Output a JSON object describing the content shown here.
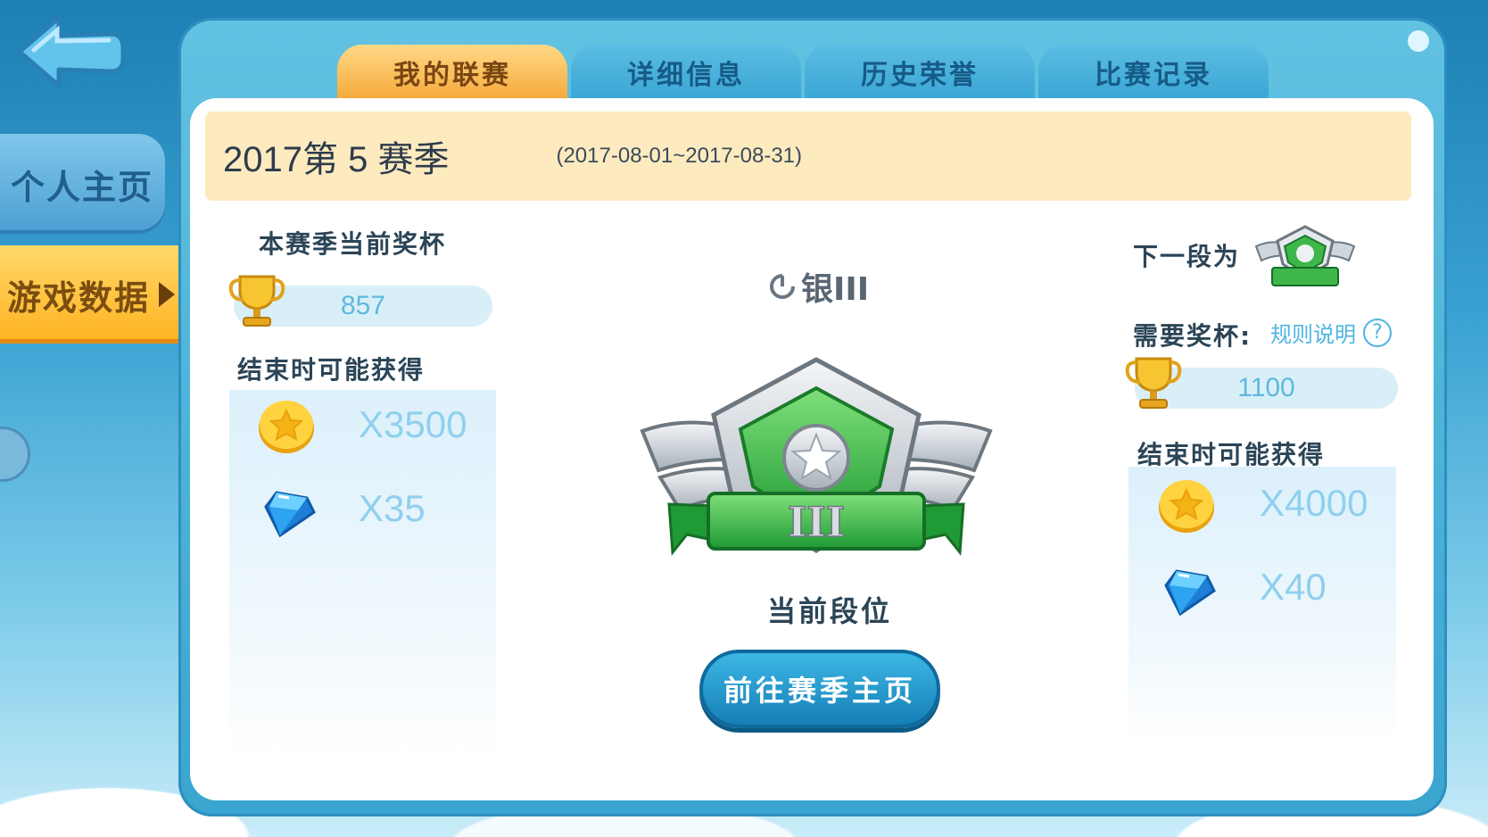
{
  "sidebar": {
    "items": [
      {
        "label": "个人主页"
      },
      {
        "label": "游戏数据"
      }
    ]
  },
  "tabs": [
    {
      "label": "我的联赛",
      "active": true
    },
    {
      "label": "详细信息",
      "active": false
    },
    {
      "label": "历史荣誉",
      "active": false
    },
    {
      "label": "比赛记录",
      "active": false
    }
  ],
  "season": {
    "title": "2017第 5 赛季",
    "dates": "(2017-08-01~2017-08-31)"
  },
  "current": {
    "trophy_label": "本赛季当前奖杯",
    "trophies": "857",
    "rewards_label": "结束时可能获得",
    "coins": "X3500",
    "gems": "X35"
  },
  "rank": {
    "name": "银III",
    "caption": "当前段位",
    "badge_numeral": "III",
    "button_label": "前往赛季主页"
  },
  "next": {
    "label": "下一段为",
    "need_label": "需要奖杯:",
    "rule_link": "规则说明",
    "help_glyph": "?",
    "trophies": "1100",
    "rewards_label": "结束时可能获得",
    "coins": "X4000",
    "gems": "X40"
  },
  "colors": {
    "accent": "#f5a93a",
    "primary": "#3aa5d4",
    "badge_green": "#3fb64a"
  }
}
